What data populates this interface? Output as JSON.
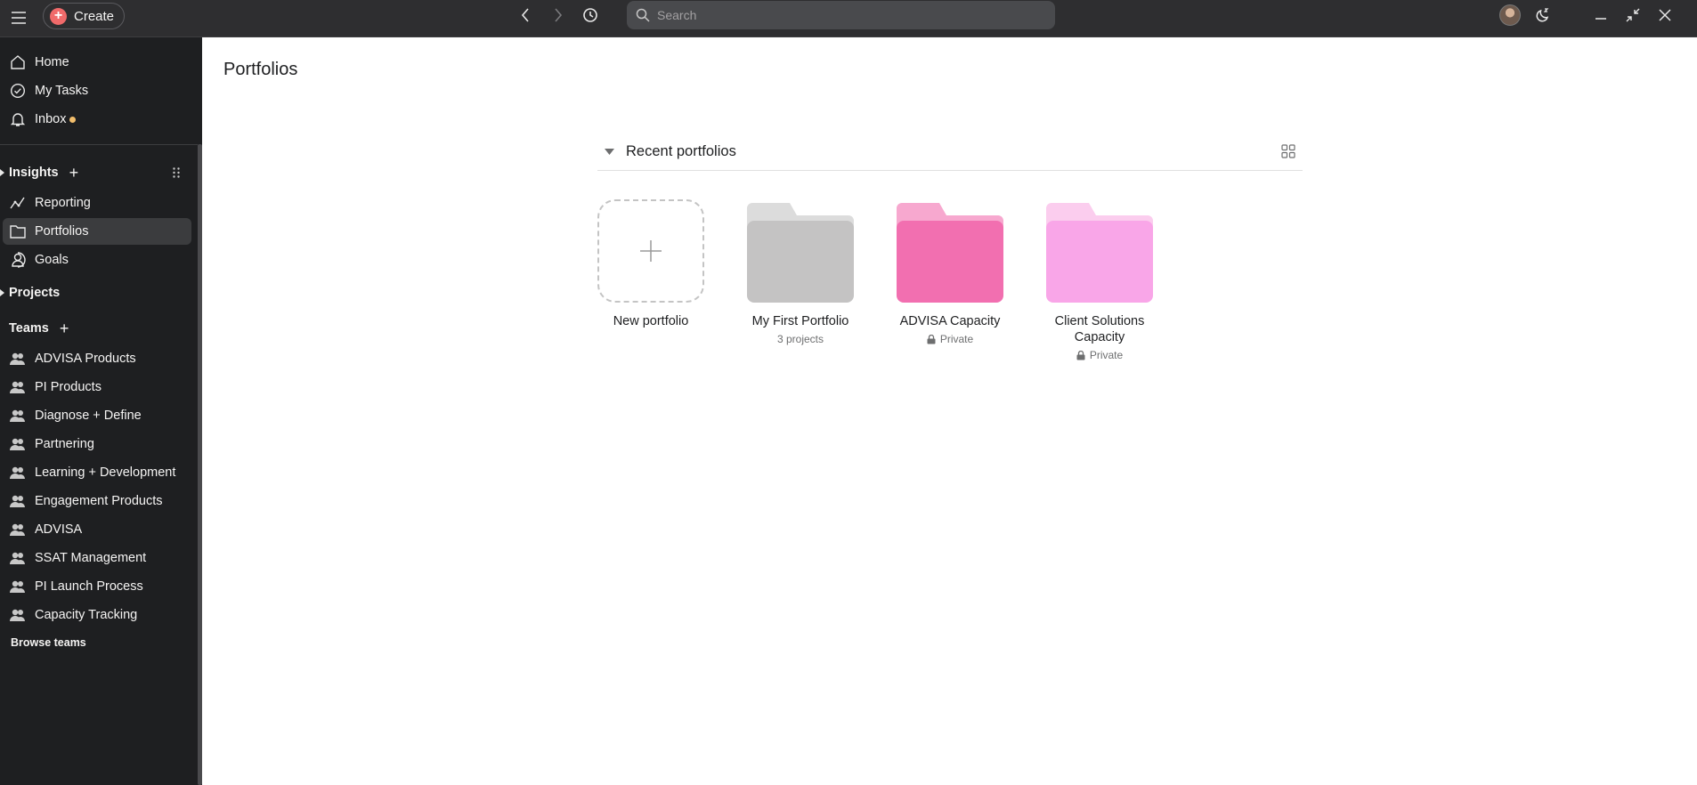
{
  "topbar": {
    "create_label": "Create",
    "search_placeholder": "Search"
  },
  "sidebar": {
    "nav": [
      {
        "label": "Home",
        "icon": "home-icon"
      },
      {
        "label": "My Tasks",
        "icon": "check-circle-icon"
      },
      {
        "label": "Inbox",
        "icon": "bell-icon",
        "has_unread_dot": true
      }
    ],
    "insights": {
      "title": "Insights",
      "items": [
        {
          "label": "Reporting",
          "icon": "line-chart-icon"
        },
        {
          "label": "Portfolios",
          "icon": "folder-icon",
          "active": true
        },
        {
          "label": "Goals",
          "icon": "person-goal-icon"
        }
      ]
    },
    "projects": {
      "title": "Projects"
    },
    "teams": {
      "title": "Teams",
      "items": [
        "ADVISA Products",
        "PI Products",
        "Diagnose + Define",
        "Partnering",
        "Learning + Development",
        "Engagement Products",
        "ADVISA",
        "SSAT Management",
        "PI Launch Process",
        "Capacity Tracking"
      ]
    },
    "browse_teams": "Browse teams"
  },
  "main": {
    "title": "Portfolios",
    "section_title": "Recent portfolios",
    "new_portfolio_label": "New portfolio",
    "portfolios": [
      {
        "name": "My First Portfolio",
        "meta": "3 projects",
        "private": false,
        "color_back": "#dcdcdc",
        "color_front": "#c4c3c3"
      },
      {
        "name": "ADVISA Capacity",
        "meta": "Private",
        "private": true,
        "color_back": "#f7a8cf",
        "color_front": "#f26fb0"
      },
      {
        "name": "Client Solutions Capacity",
        "meta": "Private",
        "private": true,
        "color_back": "#fbcdee",
        "color_front": "#f9a6e8"
      }
    ]
  },
  "colors": {
    "topbar_bg": "#2e2e30",
    "sidebar_bg": "#1e1f21",
    "accent_create": "#f06a6a",
    "inbox_dot": "#f1bd6c"
  }
}
